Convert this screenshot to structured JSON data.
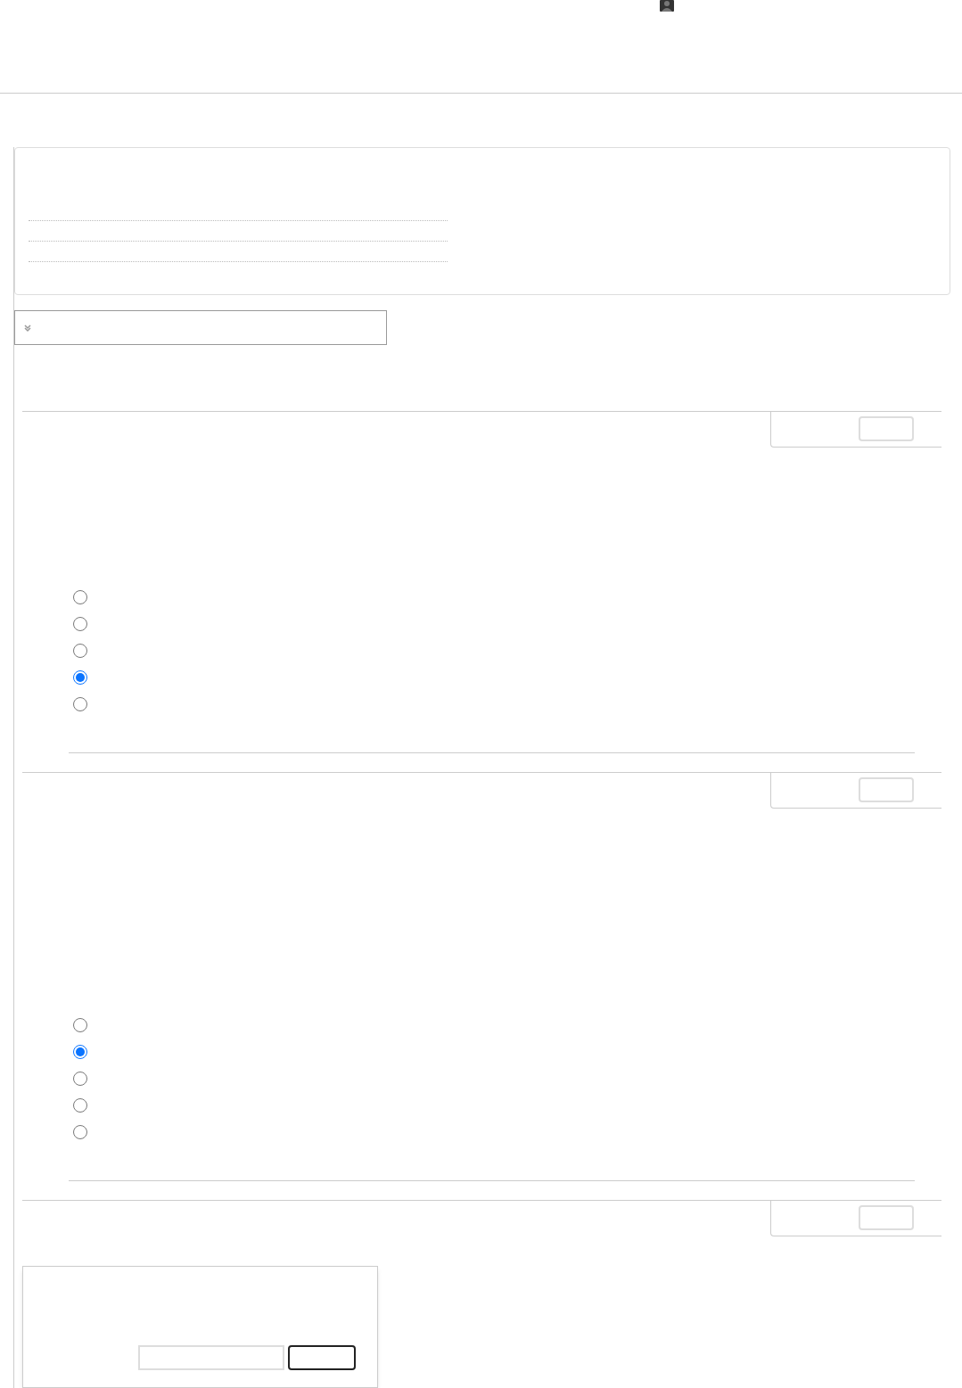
{
  "questions": [
    {
      "kind": "choice",
      "options": [
        {
          "selected": false
        },
        {
          "selected": false
        },
        {
          "selected": false
        },
        {
          "selected": true
        },
        {
          "selected": false
        }
      ]
    },
    {
      "kind": "choice",
      "options": [
        {
          "selected": false
        },
        {
          "selected": true
        },
        {
          "selected": false
        },
        {
          "selected": false
        },
        {
          "selected": false
        }
      ]
    },
    {
      "kind": "open"
    }
  ]
}
